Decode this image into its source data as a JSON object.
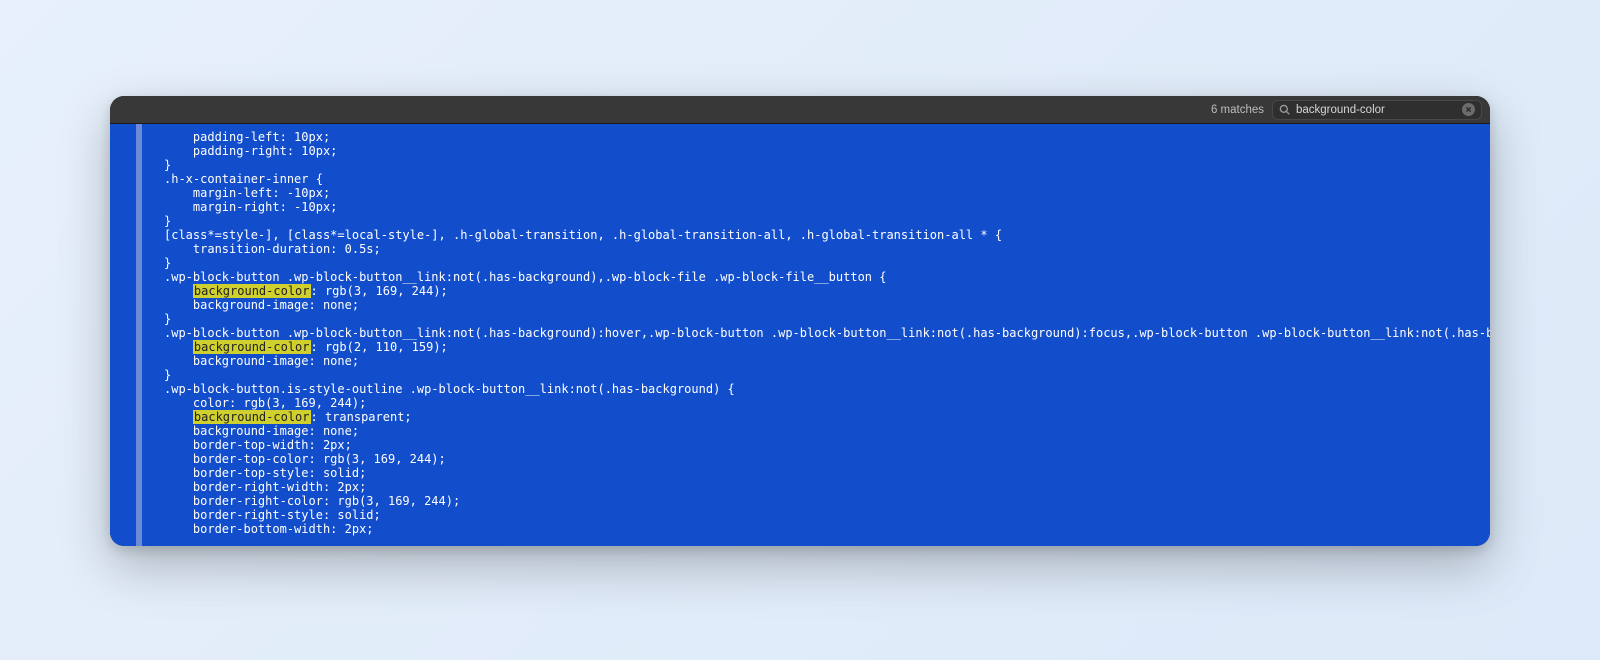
{
  "titlebar": {
    "matches_label": "6 matches",
    "search_value": "background-color"
  },
  "highlight_term": "background-color",
  "code_lines": [
    "    padding-left: 10px;",
    "    padding-right: 10px;",
    "}",
    ".h-x-container-inner {",
    "    margin-left: -10px;",
    "    margin-right: -10px;",
    "}",
    "[class*=style-], [class*=local-style-], .h-global-transition, .h-global-transition-all, .h-global-transition-all * {",
    "    transition-duration: 0.5s;",
    "}",
    ".wp-block-button .wp-block-button__link:not(.has-background),.wp-block-file .wp-block-file__button {",
    "    background-color: rgb(3, 169, 244);",
    "    background-image: none;",
    "}",
    ".wp-block-button .wp-block-button__link:not(.has-background):hover,.wp-block-button .wp-block-button__link:not(.has-background):focus,.wp-block-button .wp-block-button__link:not(.has-background):active,.wp-block-file .wp-block-file__button:hover,.wp-block-file .wp-block-file__button:focus,.wp-block-file .wp-block-file__button:active {",
    "    background-color: rgb(2, 110, 159);",
    "    background-image: none;",
    "}",
    ".wp-block-button.is-style-outline .wp-block-button__link:not(.has-background) {",
    "    color: rgb(3, 169, 244);",
    "    background-color: transparent;",
    "    background-image: none;",
    "    border-top-width: 2px;",
    "    border-top-color: rgb(3, 169, 244);",
    "    border-top-style: solid;",
    "    border-right-width: 2px;",
    "    border-right-color: rgb(3, 169, 244);",
    "    border-right-style: solid;",
    "    border-bottom-width: 2px;"
  ]
}
